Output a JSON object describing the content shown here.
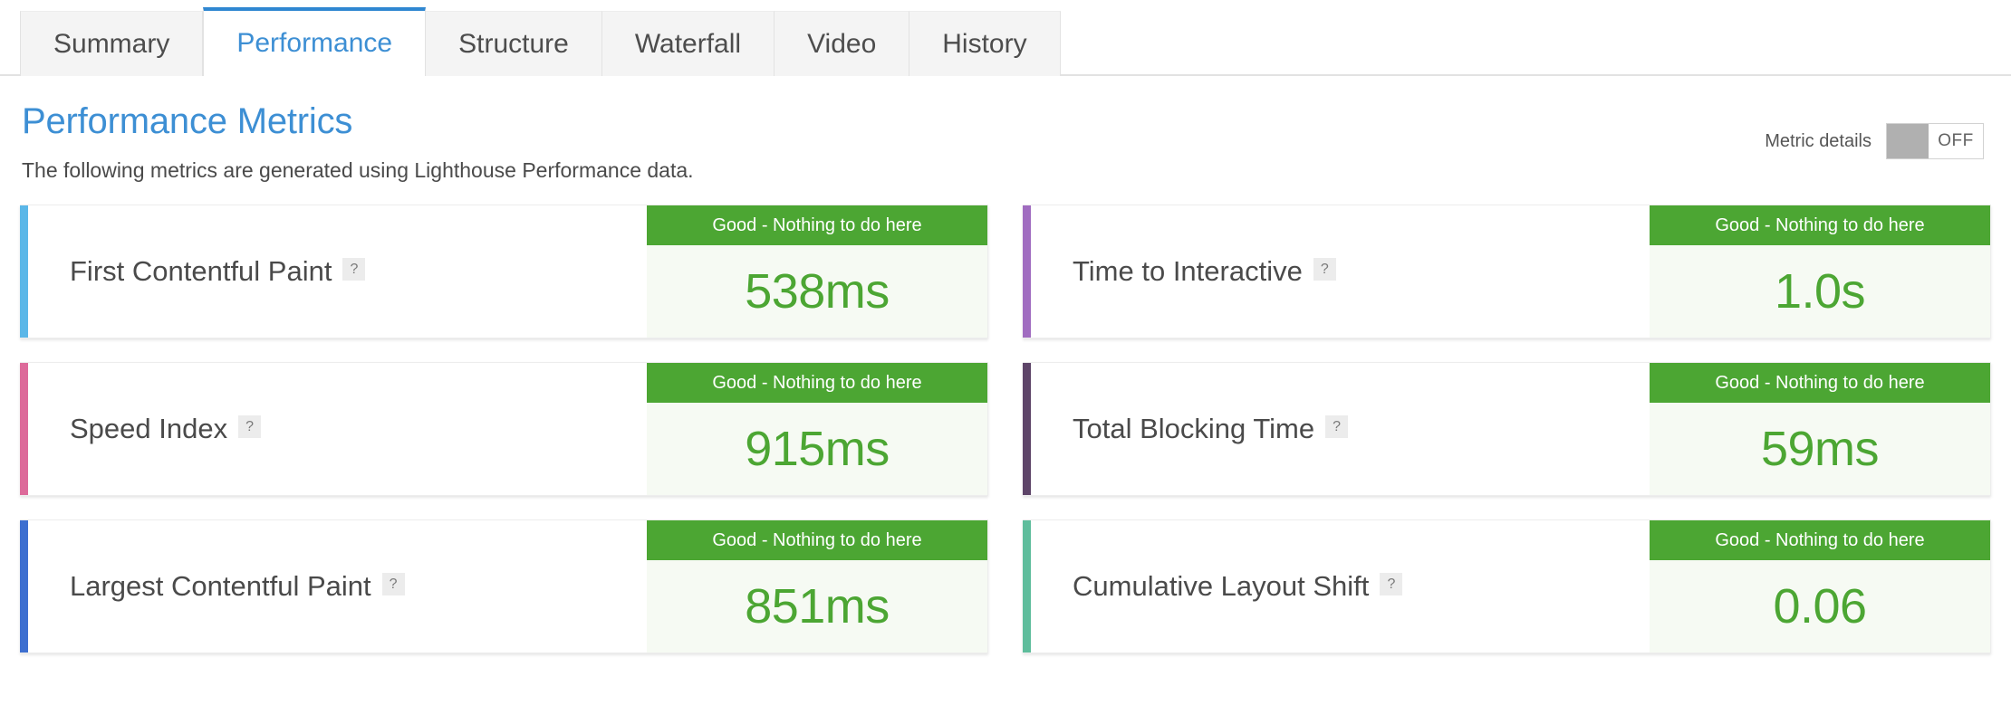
{
  "tabs": [
    {
      "label": "Summary",
      "active": false
    },
    {
      "label": "Performance",
      "active": true
    },
    {
      "label": "Structure",
      "active": false
    },
    {
      "label": "Waterfall",
      "active": false
    },
    {
      "label": "Video",
      "active": false
    },
    {
      "label": "History",
      "active": false
    }
  ],
  "header": {
    "title": "Performance Metrics",
    "subtitle": "The following metrics are generated using Lighthouse Performance data."
  },
  "metric_details_toggle": {
    "label": "Metric details",
    "state": "OFF",
    "checked": false
  },
  "help_icon_glyph": "?",
  "colors": {
    "accent_blue": "#3d8fd4",
    "good_green": "#4ca633",
    "value_bg": "#f6faf3"
  },
  "metrics": [
    {
      "name": "First Contentful Paint",
      "accent": "#5bb7e8",
      "status": "Good - Nothing to do here",
      "value": "538ms"
    },
    {
      "name": "Time to Interactive",
      "accent": "#a06cc0",
      "status": "Good - Nothing to do here",
      "value": "1.0s"
    },
    {
      "name": "Speed Index",
      "accent": "#dd6a9a",
      "status": "Good - Nothing to do here",
      "value": "915ms"
    },
    {
      "name": "Total Blocking Time",
      "accent": "#5d4468",
      "status": "Good - Nothing to do here",
      "value": "59ms"
    },
    {
      "name": "Largest Contentful Paint",
      "accent": "#3d6fd0",
      "status": "Good - Nothing to do here",
      "value": "851ms"
    },
    {
      "name": "Cumulative Layout Shift",
      "accent": "#5ebd9c",
      "status": "Good - Nothing to do here",
      "value": "0.06"
    }
  ]
}
